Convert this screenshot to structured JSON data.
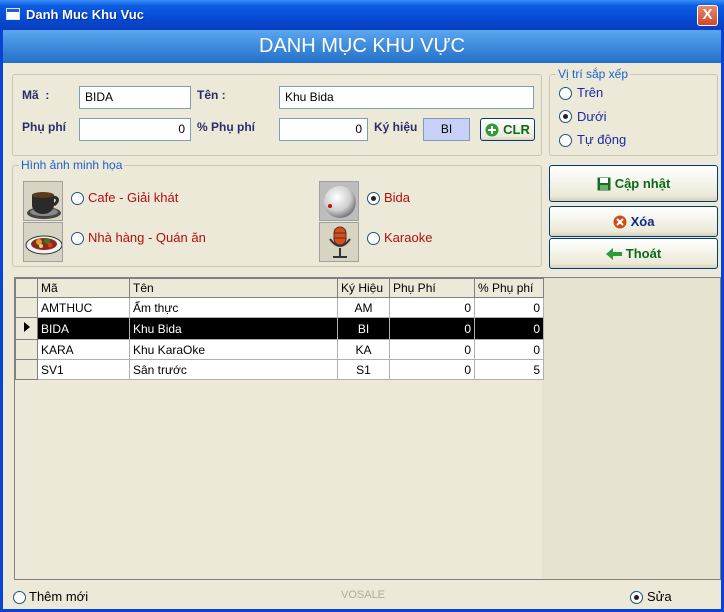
{
  "window": {
    "title": "Danh Muc Khu Vuc",
    "close_label": "X"
  },
  "banner": {
    "title": "DANH MỤC KHU VỰC"
  },
  "form": {
    "ma_label": "Mã  :",
    "ma_value": "BIDA",
    "ten_label": "Tên :",
    "ten_value": "Khu Bida",
    "phuphi_label": "Phụ phí",
    "phuphi_value": "0",
    "pct_phuphi_label": "% Phụ phí",
    "pct_phuphi_value": "0",
    "kyhieu_label": "Ký hiệu",
    "kyhieu_value": "BI",
    "clr_label": "CLR"
  },
  "position": {
    "legend": "Vị trí sắp xếp",
    "options": [
      {
        "label": "Trên",
        "selected": false
      },
      {
        "label": "Dưới",
        "selected": true
      },
      {
        "label": "Tự động",
        "selected": false
      }
    ]
  },
  "images": {
    "legend": "Hình ảnh minh họa",
    "options": [
      {
        "label": "Cafe - Giải khát",
        "icon": "coffee-cup-icon",
        "selected": false
      },
      {
        "label": "Nhà hàng - Quán ăn",
        "icon": "food-plate-icon",
        "selected": false
      },
      {
        "label": "Bida",
        "icon": "billiard-ball-icon",
        "selected": true
      },
      {
        "label": "Karaoke",
        "icon": "microphone-icon",
        "selected": false
      }
    ]
  },
  "actions": {
    "update_label": "Cập nhật",
    "delete_label": "Xóa",
    "exit_label": "Thoát"
  },
  "grid": {
    "columns": [
      "Mã",
      "Tên",
      "Ký Hiệu",
      "Phụ Phí",
      "% Phụ phí"
    ],
    "rows": [
      {
        "ma": "AMTHUC",
        "ten": "Ẩm thực",
        "kyhieu": "AM",
        "phuphi": "0",
        "pct": "0",
        "selected": false
      },
      {
        "ma": "BIDA",
        "ten": "Khu Bida",
        "kyhieu": "BI",
        "phuphi": "0",
        "pct": "0",
        "selected": true
      },
      {
        "ma": "KARA",
        "ten": "Khu KaraOke",
        "kyhieu": "KA",
        "phuphi": "0",
        "pct": "0",
        "selected": false
      },
      {
        "ma": "SV1",
        "ten": "Sân trước",
        "kyhieu": "S1",
        "phuphi": "0",
        "pct": "5",
        "selected": false
      }
    ]
  },
  "footer": {
    "add_new_label": "Thêm mới",
    "add_new_selected": false,
    "watermark": "VOSALE",
    "edit_label": "Sửa",
    "edit_selected": true
  },
  "colors": {
    "title_bar": "#0548d0",
    "banner": "#3a88e0",
    "legend_text": "#1b5fd0",
    "image_option_text": "#b01010",
    "position_option_text": "#1a2aa0",
    "action_text": "#0a6a1a",
    "delete_icon": "#d24a1a"
  }
}
